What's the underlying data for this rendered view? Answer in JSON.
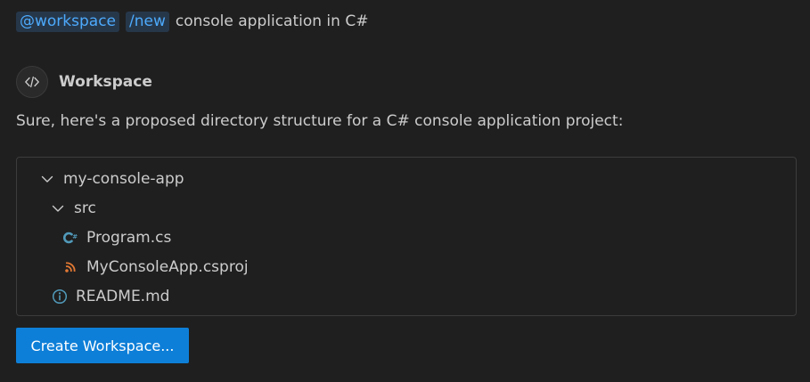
{
  "prompt": {
    "agent_chip": "@workspace",
    "command_chip": "/new",
    "text": "console application in C#"
  },
  "agent": {
    "icon": "code-brackets-icon",
    "name": "Workspace"
  },
  "response": {
    "text": "Sure, here's a proposed directory structure for a C# console application project:"
  },
  "tree": {
    "root": {
      "label": "my-console-app",
      "icon": "chevron-down-icon",
      "expanded": true
    },
    "src": {
      "label": "src",
      "icon": "chevron-down-icon",
      "expanded": true
    },
    "program": {
      "label": "Program.cs",
      "icon": "csharp-file-icon",
      "icon_color": "#519aba"
    },
    "csproj": {
      "label": "MyConsoleApp.csproj",
      "icon": "rss-xml-file-icon",
      "icon_color": "#e37933"
    },
    "readme": {
      "label": "README.md",
      "icon": "info-icon",
      "icon_color": "#519aba"
    }
  },
  "actions": {
    "create_label": "Create Workspace..."
  },
  "colors": {
    "background": "#1f1f1f",
    "chip_background": "#26374a",
    "chip_text": "#4daafc",
    "button": "#0e7fd8",
    "border": "#3c3c3c"
  }
}
